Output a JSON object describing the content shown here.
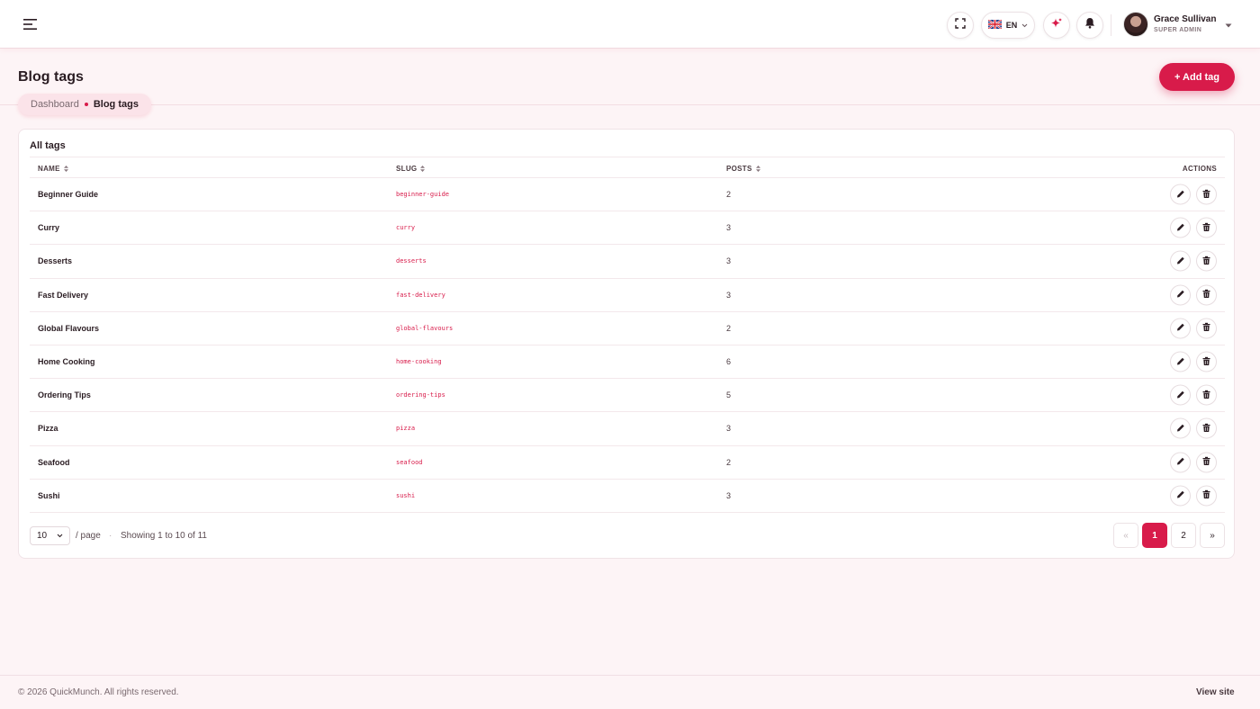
{
  "topbar": {
    "language": "EN",
    "user": {
      "name": "Grace Sullivan",
      "role": "SUPER ADMIN"
    }
  },
  "page": {
    "title": "Blog tags",
    "add_button": "+ Add tag",
    "breadcrumb": {
      "home": "Dashboard",
      "current": "Blog tags"
    }
  },
  "table": {
    "card_title": "All tags",
    "columns": {
      "name": "NAME",
      "slug": "SLUG",
      "posts": "POSTS",
      "actions": "ACTIONS"
    },
    "rows": [
      {
        "name": "Beginner Guide",
        "slug": "beginner-guide",
        "posts": "2"
      },
      {
        "name": "Curry",
        "slug": "curry",
        "posts": "3"
      },
      {
        "name": "Desserts",
        "slug": "desserts",
        "posts": "3"
      },
      {
        "name": "Fast Delivery",
        "slug": "fast-delivery",
        "posts": "3"
      },
      {
        "name": "Global Flavours",
        "slug": "global-flavours",
        "posts": "2"
      },
      {
        "name": "Home Cooking",
        "slug": "home-cooking",
        "posts": "6"
      },
      {
        "name": "Ordering Tips",
        "slug": "ordering-tips",
        "posts": "5"
      },
      {
        "name": "Pizza",
        "slug": "pizza",
        "posts": "3"
      },
      {
        "name": "Seafood",
        "slug": "seafood",
        "posts": "2"
      },
      {
        "name": "Sushi",
        "slug": "sushi",
        "posts": "3"
      }
    ]
  },
  "pagination": {
    "per_page": "10",
    "per_page_suffix": "/ page",
    "separator": "·",
    "showing": "Showing 1 to 10 of 11",
    "prev": "«",
    "pages": [
      "1",
      "2"
    ],
    "current_page": "1",
    "next": "»"
  },
  "footer": {
    "copyright": "© 2026 QuickMunch. All rights reserved.",
    "view_site": "View site"
  },
  "colors": {
    "accent": "#d81b4a",
    "background": "#fdf4f6"
  },
  "icons": [
    "menu-icon",
    "fullscreen-icon",
    "uk-flag-icon",
    "sparkle-icon",
    "bell-icon",
    "chevron-down-icon",
    "sort-icon",
    "pencil-icon",
    "trash-icon"
  ]
}
